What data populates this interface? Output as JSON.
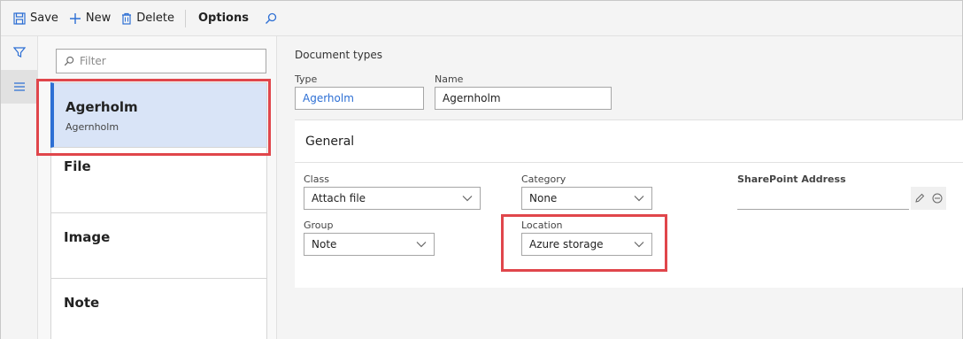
{
  "toolbar": {
    "save_label": "Save",
    "new_label": "New",
    "delete_label": "Delete",
    "options_label": "Options"
  },
  "filter": {
    "placeholder": "Filter"
  },
  "list": {
    "items": [
      {
        "title": "Agerholm",
        "subtitle": "Agernholm"
      },
      {
        "title": "File",
        "subtitle": ""
      },
      {
        "title": "Image",
        "subtitle": ""
      },
      {
        "title": "Note",
        "subtitle": ""
      }
    ]
  },
  "main": {
    "section_title": "Document types",
    "type_label": "Type",
    "type_value": "Agerholm",
    "name_label": "Name",
    "name_value": "Agernholm",
    "general_title": "General",
    "class_label": "Class",
    "class_value": "Attach file",
    "category_label": "Category",
    "category_value": "None",
    "sharepoint_label": "SharePoint Address",
    "sharepoint_value": "",
    "group_label": "Group",
    "group_value": "Note",
    "location_label": "Location",
    "location_value": "Azure storage"
  },
  "colors": {
    "accent": "#2d6fd4",
    "highlight": "#e0464b",
    "selected_bg": "#d9e4f7"
  }
}
